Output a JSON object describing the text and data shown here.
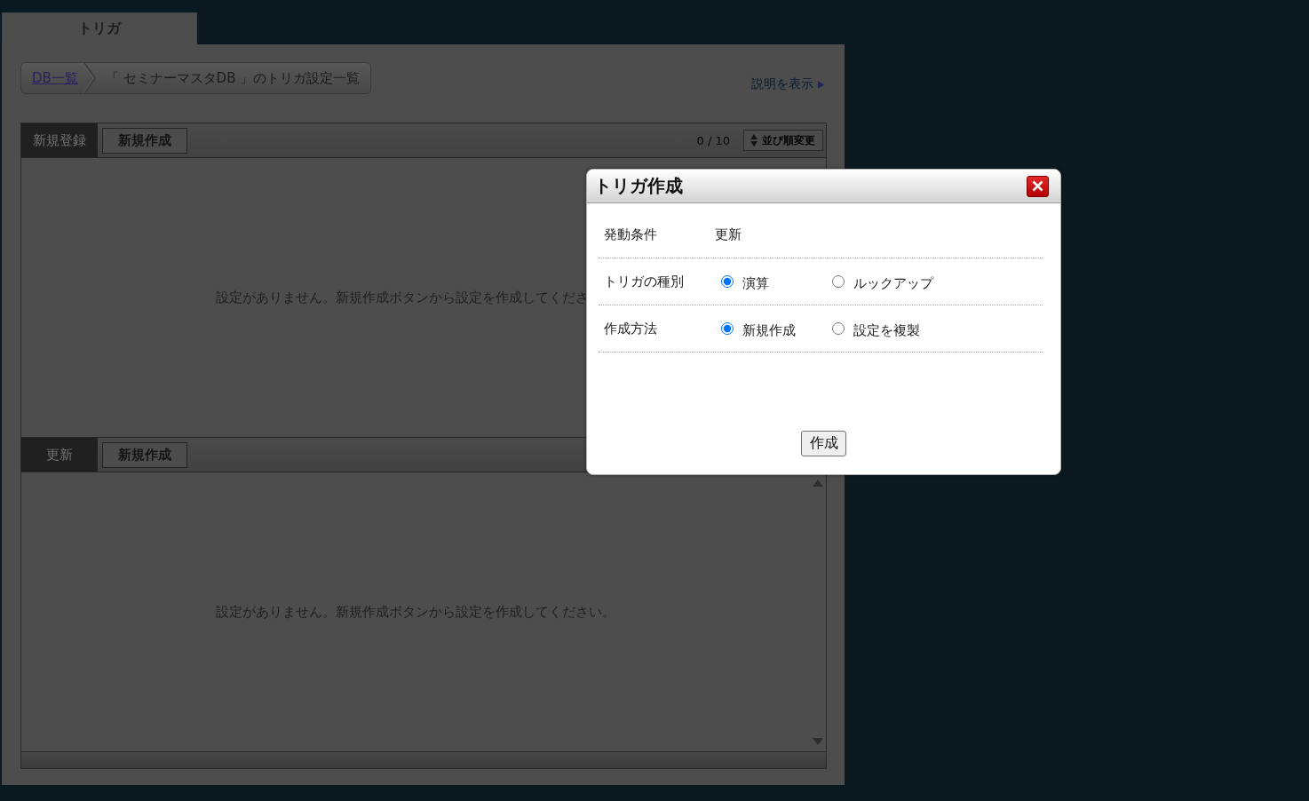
{
  "tabs": [
    {
      "label": "トリガ",
      "selected": true
    }
  ],
  "breadcrumb": [
    {
      "label": "DB一覧",
      "kind": "link"
    },
    {
      "label": "「 セミナーマスタDB 」のトリガ設定一覧",
      "kind": "current"
    }
  ],
  "help_link": {
    "label": "説明を表示"
  },
  "sections": [
    {
      "label": "新規登録",
      "button": "新規作成",
      "count": "0 / 10",
      "sort_button": "並び順変更",
      "message": "設定がありません。新規作成ボタンから設定を作成してくださ"
    },
    {
      "label": "更新",
      "button": "新規作成",
      "message": "設定がありません。新規作成ボタンから設定を作成してください。"
    }
  ],
  "dialog": {
    "title": "トリガ作成",
    "rows": [
      {
        "kind": "text",
        "label": "発動条件",
        "value": "更新"
      },
      {
        "kind": "radio",
        "label": "トリガの種別",
        "options": [
          {
            "label": "演算",
            "selected": true
          },
          {
            "label": "ルックアップ",
            "selected": false
          }
        ]
      },
      {
        "kind": "radio",
        "label": "作成方法",
        "options": [
          {
            "label": "新規作成",
            "selected": true
          },
          {
            "label": "設定を複製",
            "selected": false
          }
        ]
      }
    ],
    "submit": "作成"
  }
}
